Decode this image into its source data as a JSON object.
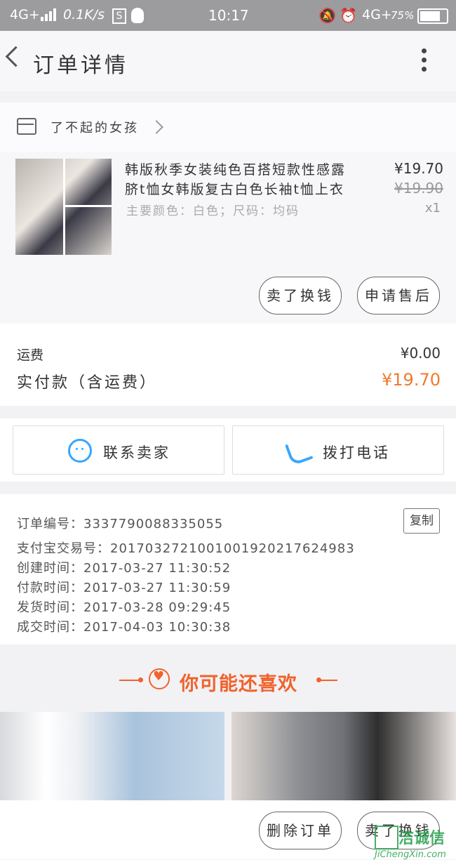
{
  "status_bar": {
    "network": "4G+",
    "speed": "0.1K/s",
    "time": "10:17",
    "network2": "4G+",
    "battery": "75%"
  },
  "nav": {
    "title": "订单详情"
  },
  "shop": {
    "name": "了不起的女孩"
  },
  "product": {
    "title": "韩版秋季女装纯色百搭短款性感露脐t恤女韩版复古白色长袖t恤上衣",
    "spec": "主要颜色：白色；尺码：均码",
    "price": "¥19.70",
    "original_price": "¥19.90",
    "quantity": "x1",
    "buttons": {
      "sell_exchange": "卖了换钱",
      "after_sale": "申请售后"
    }
  },
  "fees": {
    "shipping_label": "运费",
    "shipping_value": "¥0.00",
    "paid_label": "实付款（含运费）",
    "paid_value": "¥19.70"
  },
  "contact": {
    "seller_label": "联系卖家",
    "call_label": "拨打电话"
  },
  "order_info": {
    "copy_label": "复制",
    "rows": [
      "订单编号：3337790088335055",
      "支付宝交易号：2017032721001001920217624983",
      "创建时间：2017-03-27  11:30:52",
      "付款时间：2017-03-27  11:30:59",
      "发货时间：2017-03-28  09:29:45",
      "成交时间：2017-04-03  10:30:38"
    ]
  },
  "recommend": {
    "title": "你可能还喜欢"
  },
  "bottom_bar": {
    "delete_label": "删除订单",
    "sell_exchange_label": "卖了换钱"
  },
  "watermark": {
    "text": "JiChengXin.com",
    "brand": "洁诚信"
  },
  "colors": {
    "accent_orange": "#f07a2c",
    "recommend_red": "#f0622c",
    "icon_blue": "#37a6ff"
  }
}
